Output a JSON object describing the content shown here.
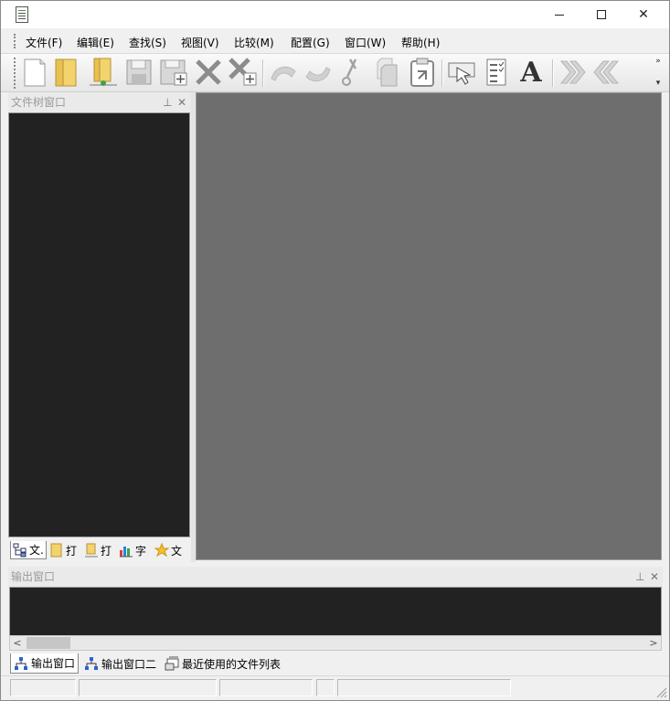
{
  "window": {
    "icon": "notepad-document-icon",
    "controls": {
      "minimize_icon": "minimize-icon",
      "maximize_icon": "maximize-icon",
      "close_glyph": "✕"
    }
  },
  "menu": [
    "文件(F)",
    "编辑(E)",
    "查找(S)",
    "视图(V)",
    "比较(M)",
    "配置(G)",
    "窗口(W)",
    "帮助(H)"
  ],
  "toolbar": {
    "buttons": [
      "new-file-icon",
      "open-file-icon",
      "open-folder-icon",
      "save-icon",
      "save-all-icon",
      "close-icon",
      "close-all-icon",
      "undo-icon",
      "redo-icon",
      "cut-icon",
      "copy-icon",
      "paste-icon",
      "select-icon",
      "list-icon",
      "font-icon",
      "next-icon",
      "previous-icon"
    ],
    "font_glyph": "A",
    "overflow_glyph": "»"
  },
  "file_tree_panel": {
    "title": "文件树窗口",
    "pin_glyph": "⊥",
    "close_glyph": "✕",
    "tabs": [
      "文.",
      "打",
      "打",
      "字",
      "文"
    ]
  },
  "output_panel": {
    "title": "输出窗口",
    "pin_glyph": "⊥",
    "close_glyph": "✕",
    "scroll_left": "<",
    "scroll_right": ">",
    "tabs": [
      "输出窗口",
      "输出窗口二",
      "最近使用的文件列表"
    ]
  },
  "colors": {
    "panel_dark": "#222222",
    "editor_area": "#6e6e6e",
    "title_inactive": "#9a9a9a"
  }
}
